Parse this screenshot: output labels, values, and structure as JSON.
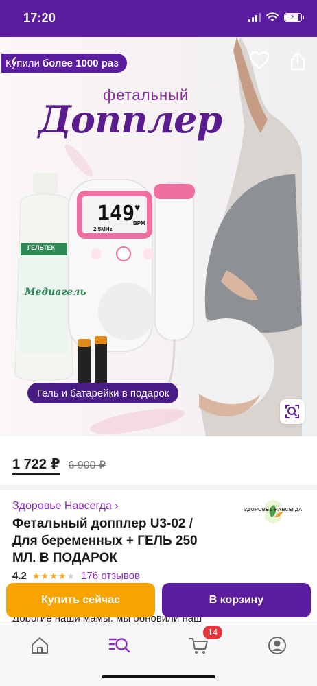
{
  "status_bar": {
    "time": "17:20"
  },
  "hero": {
    "badge_prefix": "Купили",
    "badge_bold": "более 1000 раз",
    "subtitle": "фетальный",
    "title": "Допплер",
    "device_screen": {
      "bpm_value": "149",
      "bpm_unit": "BPM",
      "frequency": "2.5MHz"
    },
    "gel_brand": "ГЕЛЬТЕК",
    "gel_label": "Медиагель",
    "gift_caption": "Гель и батарейки в подарок"
  },
  "product": {
    "price": "1 722 ₽",
    "old_price": "6 900 ₽",
    "seller": "Здоровье Навсегда ›",
    "seller_logo_text": "ЗДОРОВЬЕ НАВСЕГДА",
    "title_lines": [
      "Фетальный допплер U3-02 /",
      "Для беременных + ГЕЛЬ 250",
      "МЛ. В ПОДАРОК"
    ],
    "rating": "4.2",
    "rating_value": 4.2,
    "rating_max": 5,
    "stars_filled": "★★★★",
    "stars_empty": "★",
    "reviews": "176 отзывов",
    "description_preview": "Дорогие наши мамы, мы обновили наш"
  },
  "actions": {
    "buy_now": "Купить сейчас",
    "add_to_cart": "В корзину"
  },
  "bottom_nav": {
    "items": [
      "home-icon",
      "catalog-search-icon",
      "cart-icon",
      "profile-icon"
    ],
    "cart_count": "14"
  },
  "colors": {
    "brand_purple": "#5b1c9e",
    "buy_orange": "#f7a400",
    "seller_link": "#8b2cc0",
    "star": "#f5a623",
    "badge_red": "#e8353b"
  }
}
